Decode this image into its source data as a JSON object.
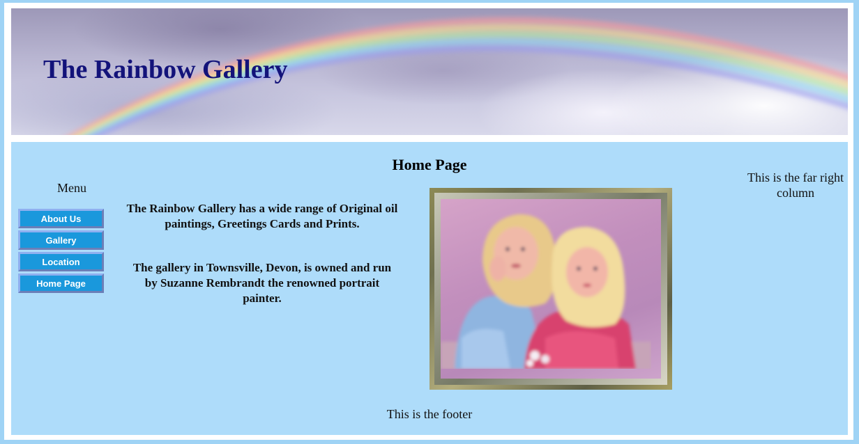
{
  "header": {
    "site_title": "The Rainbow Gallery"
  },
  "main": {
    "page_title": "Home Page",
    "intro_paragraphs": [
      "The Rainbow Gallery has a wide range of Original oil paintings, Greetings Cards and Prints.",
      "The gallery in Townsville, Devon, is owned and run by Suzanne Rembrandt the renowned portrait painter."
    ]
  },
  "menu": {
    "heading": "Menu",
    "items": [
      {
        "label": "About Us"
      },
      {
        "label": "Gallery"
      },
      {
        "label": "Location"
      },
      {
        "label": "Home Page"
      }
    ]
  },
  "right_column": {
    "text": "This is the far right column"
  },
  "footer": {
    "text": "This is the footer"
  },
  "colors": {
    "title": "#13137a",
    "content_bg": "#aedcfa",
    "button_bg": "#1a98dc",
    "outer_bg": "#9fd3f5"
  }
}
